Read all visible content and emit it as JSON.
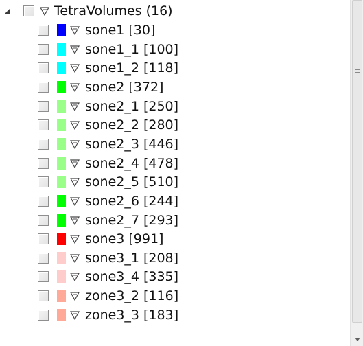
{
  "tree": {
    "root": {
      "label": "TetraVolumes (16)",
      "expanded": true,
      "checked": false
    },
    "items": [
      {
        "label": "sone1 [30]",
        "color": "#0000ff",
        "checked": false
      },
      {
        "label": "sone1_1 [100]",
        "color": "#00ffff",
        "checked": false
      },
      {
        "label": "sone1_2 [118]",
        "color": "#00ffff",
        "checked": false
      },
      {
        "label": "sone2 [372]",
        "color": "#00ff00",
        "checked": false
      },
      {
        "label": "sone2_1 [250]",
        "color": "#99ff88",
        "checked": false
      },
      {
        "label": "sone2_2 [280]",
        "color": "#99ff88",
        "checked": false
      },
      {
        "label": "sone2_3 [446]",
        "color": "#99ff88",
        "checked": false
      },
      {
        "label": "sone2_4 [478]",
        "color": "#99ff88",
        "checked": false
      },
      {
        "label": "sone2_5 [510]",
        "color": "#99ff88",
        "checked": false
      },
      {
        "label": "sone2_6 [244]",
        "color": "#00ff00",
        "checked": false
      },
      {
        "label": "sone2_7 [293]",
        "color": "#00ff00",
        "checked": false
      },
      {
        "label": "sone3 [991]",
        "color": "#ff0000",
        "checked": false
      },
      {
        "label": "sone3_1 [208]",
        "color": "#ffcccc",
        "checked": false
      },
      {
        "label": "sone3_4 [335]",
        "color": "#ffcccc",
        "checked": false
      },
      {
        "label": "zone3_2 [116]",
        "color": "#ffaa99",
        "checked": false
      },
      {
        "label": "zone3_3 [183]",
        "color": "#ffaa99",
        "checked": false
      }
    ]
  },
  "icons": {
    "expander": "expanded-triangle-icon",
    "visibility": "filter-triangle-icon"
  }
}
